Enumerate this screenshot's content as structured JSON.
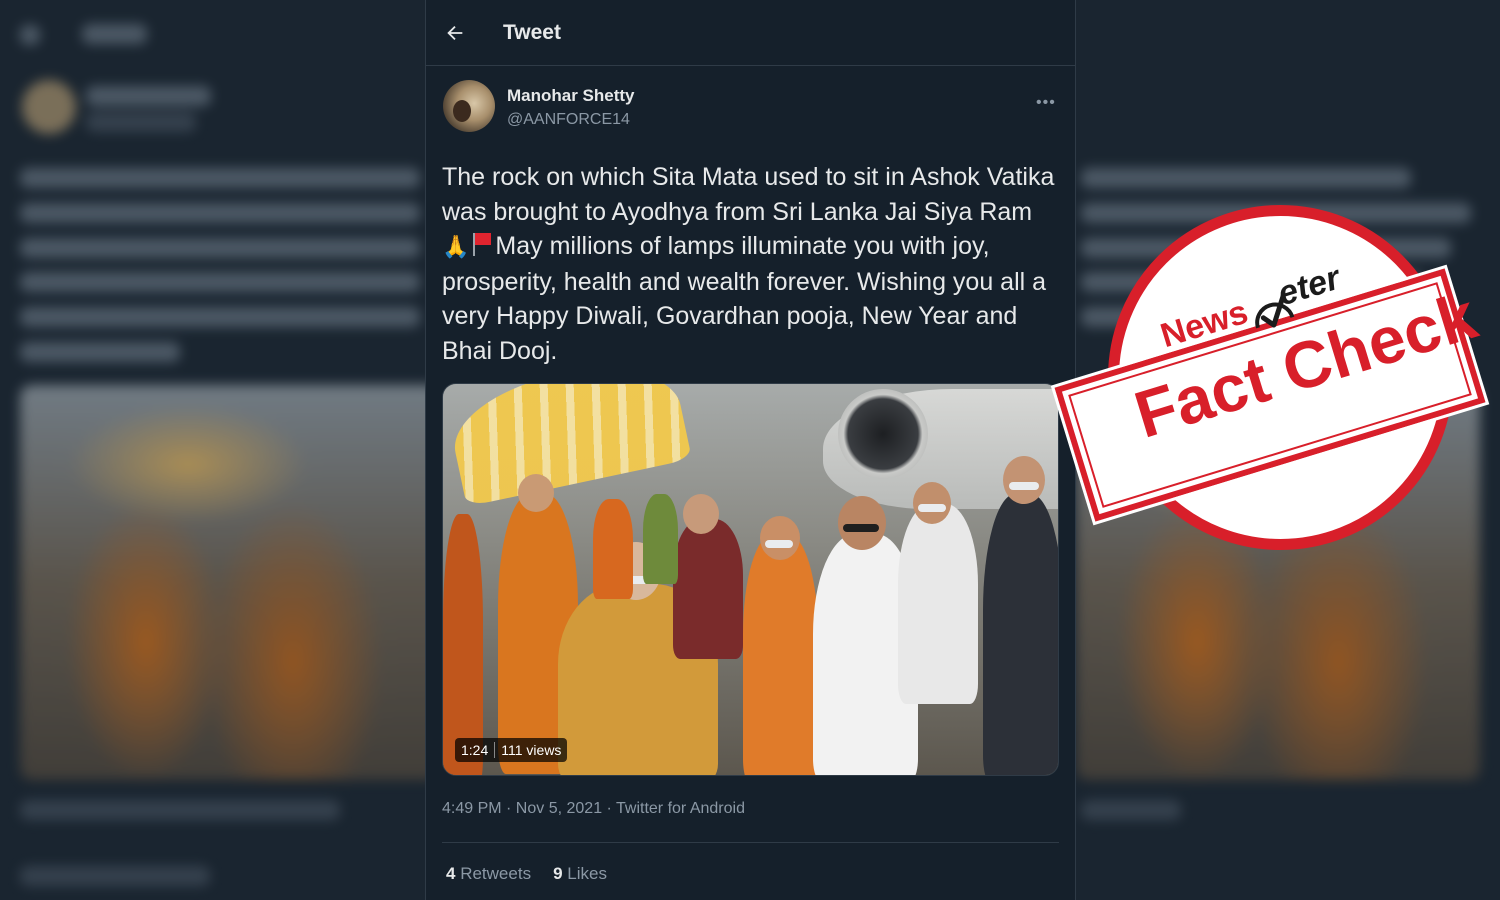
{
  "header": {
    "title": "Tweet"
  },
  "tweet": {
    "author_name": "Manohar Shetty",
    "author_handle": "@AANFORCE14",
    "more_label": "•••",
    "text_part1": "The rock on which Sita Mata used to sit in Ashok Vatika was brought to Ayodhya from Sri Lanka Jai Siya Ram ",
    "emoji_pray": "🙏",
    "text_part2": "May millions of lamps illuminate you with joy, prosperity, health and wealth forever. Wishing you all a very Happy Diwali, Govardhan pooja, New Year and Bhai Dooj.",
    "video": {
      "duration": "1:24",
      "views": "111 views"
    },
    "timestamp": "4:49 PM · Nov 5, 2021 · Twitter for Android",
    "retweets_count": "4",
    "retweets_label": "Retweets",
    "likes_count": "9",
    "likes_label": "Likes"
  },
  "stamp": {
    "brand_part1": "News",
    "brand_part2": "eter",
    "label": "Fact Check"
  },
  "colors": {
    "background": "#15202b",
    "stamp_red": "#d81f2a",
    "text_primary": "#e7e9ea",
    "text_secondary": "#8b98a5"
  },
  "icons": [
    "arrow-left-icon",
    "more-icon",
    "pray-hands-emoji",
    "red-flag-emoji",
    "meter-check-icon"
  ]
}
